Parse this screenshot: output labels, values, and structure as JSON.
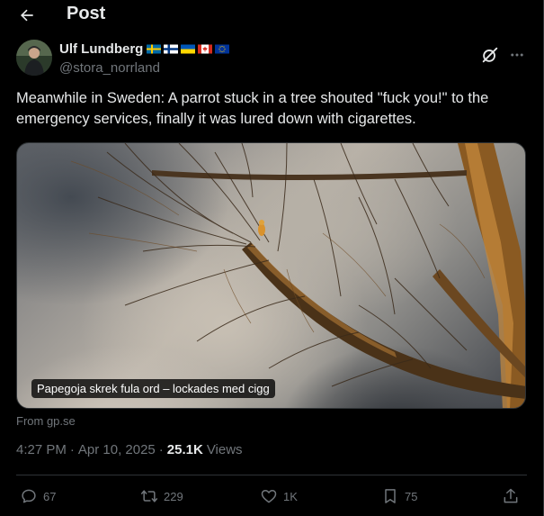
{
  "header": {
    "title": "Post",
    "back_icon": "arrow-left-icon"
  },
  "author": {
    "display_name": "Ulf Lundberg",
    "handle": "@stora_norrland",
    "flags": [
      "sweden-flag-icon",
      "finland-flag-icon",
      "ukraine-flag-icon",
      "canada-flag-icon",
      "eu-flag-icon"
    ]
  },
  "tweet": {
    "text": "Meanwhile in Sweden: A parrot stuck in a tree shouted \"fuck you!\" to the emergency services, finally it was lured down with cigarettes.",
    "media_caption": "Papegoja skrek fula ord – lockades med cigg",
    "source": "From gp.se"
  },
  "meta": {
    "time": "4:27 PM",
    "date": "Apr 10, 2025",
    "separator": "·",
    "views_count": "25.1K",
    "views_label": "Views"
  },
  "actions": {
    "replies": "67",
    "reposts": "229",
    "likes": "1K",
    "bookmarks": "75"
  },
  "colors": {
    "background": "#000000",
    "text": "#e7e9ea",
    "muted": "#71767b",
    "border": "#2f3336"
  }
}
